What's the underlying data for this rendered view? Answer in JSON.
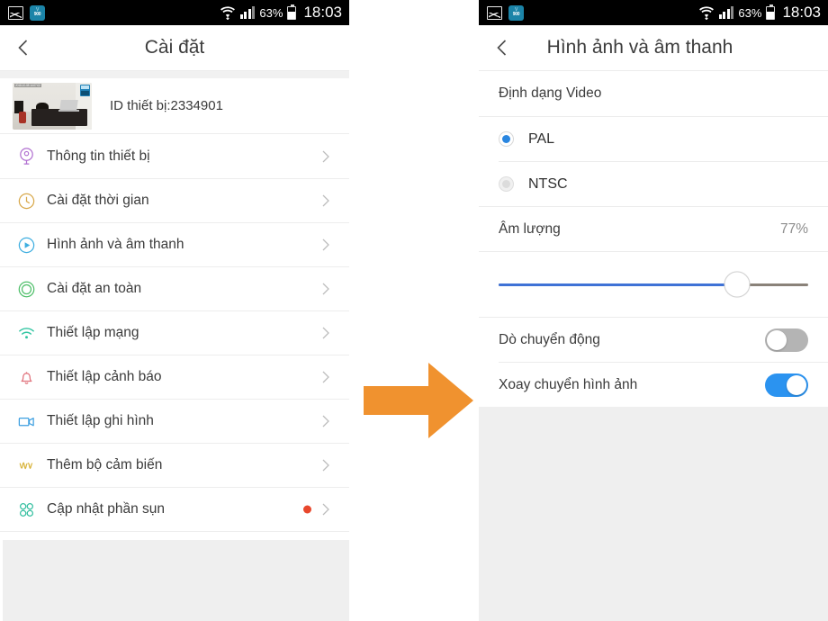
{
  "status_bar": {
    "icons": [
      "gallery-icon",
      "app-icon"
    ],
    "app_icon_top_text": "V",
    "app_icon_bottom_text": "900",
    "wifi_icon": "wifi-icon",
    "signal_icon": "signal-bars-icon",
    "battery_percent": "63%",
    "battery_icon": "battery-icon",
    "time": "18:03"
  },
  "left_screen": {
    "back_label": "back",
    "title": "Cài đặt",
    "device": {
      "thumbnail_timestamp": "2018-10-08 14:07:02",
      "id_label": "ID thiết bị:2334901"
    },
    "items": [
      {
        "label": "Thông tin thiết bị",
        "icon": "camera-device-icon",
        "color": "#b06fd0",
        "badge": false
      },
      {
        "label": "Cài đặt thời gian",
        "icon": "clock-icon",
        "color": "#d8a84a",
        "badge": false
      },
      {
        "label": "Hình ảnh và âm thanh",
        "icon": "play-circle-icon",
        "color": "#3eaee0",
        "badge": false
      },
      {
        "label": "Cài đặt an toàn",
        "icon": "shield-ring-icon",
        "color": "#4fbf6a",
        "badge": false
      },
      {
        "label": "Thiết lập mạng",
        "icon": "wifi-icon",
        "color": "#2ec4a0",
        "badge": false
      },
      {
        "label": "Thiết lập cảnh báo",
        "icon": "bell-icon",
        "color": "#e0707a",
        "badge": false
      },
      {
        "label": "Thiết lập ghi hình",
        "icon": "video-camera-icon",
        "color": "#3c9fe0",
        "badge": false
      },
      {
        "label": "Thêm bộ cảm biến",
        "icon": "sensor-wave-icon",
        "color": "#d8b43c",
        "badge": false
      },
      {
        "label": "Cập nhật phần sụn",
        "icon": "firmware-circles-icon",
        "color": "#35bfa0",
        "badge": true
      }
    ],
    "chevron_icon": "chevron-right-icon",
    "badge_color": "#e8472c"
  },
  "right_screen": {
    "back_label": "back",
    "title": "Hình ảnh và âm thanh",
    "section_video_format": "Định dạng Video",
    "radio_options": [
      {
        "label": "PAL",
        "selected": true
      },
      {
        "label": "NTSC",
        "selected": false
      }
    ],
    "volume": {
      "label": "Âm lượng",
      "value_text": "77%",
      "percent": 77,
      "fill_color": "#3f72d6",
      "track_color": "#8a8279"
    },
    "toggles": [
      {
        "label": "Dò chuyển động",
        "on": false
      },
      {
        "label": "Xoay chuyển hình ảnh",
        "on": true
      }
    ],
    "toggle_on_color": "#2b93f0",
    "toggle_off_color": "#b4b4b4"
  },
  "arrow": {
    "name": "right-arrow",
    "color": "#f0922f"
  }
}
